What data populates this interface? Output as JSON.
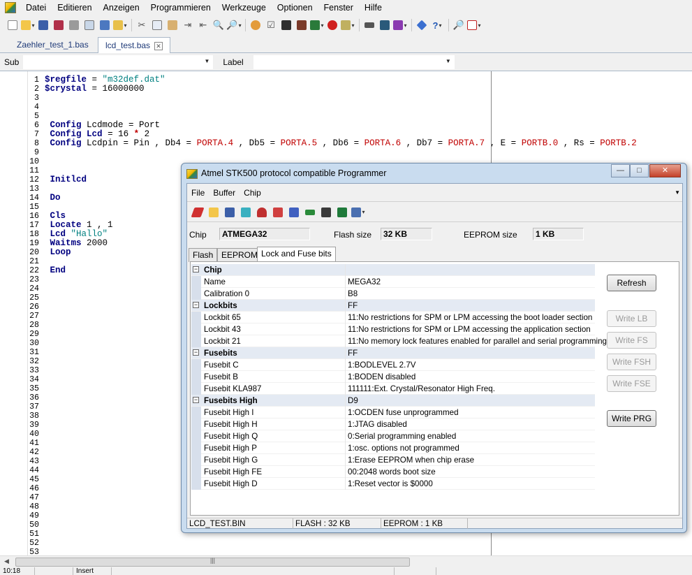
{
  "menu": [
    "Datei",
    "Editieren",
    "Anzeigen",
    "Programmieren",
    "Werkzeuge",
    "Optionen",
    "Fenster",
    "Hilfe"
  ],
  "doc_tabs": [
    {
      "label": "Zaehler_test_1.bas",
      "active": false
    },
    {
      "label": "lcd_test.bas",
      "active": true
    }
  ],
  "sub_label_bar": {
    "sub": "Sub",
    "label": "Label"
  },
  "editor": {
    "lines": [
      {
        "n": "1",
        "html": "<span class=\"kw\">$regfile</span> = <span class=\"str\">\"m32def.dat\"</span>"
      },
      {
        "n": "2",
        "html": "<span class=\"kw\">$crystal</span> = 16000000"
      },
      {
        "n": "3",
        "html": ""
      },
      {
        "n": "4",
        "html": ""
      },
      {
        "n": "5",
        "html": ""
      },
      {
        "n": "6",
        "html": " <span class=\"kw\">Config</span> Lcdmode = Port"
      },
      {
        "n": "7",
        "html": " <span class=\"kw\">Config</span> <span class=\"kw\">Lcd</span> = 16 <span class=\"op\">*</span> 2"
      },
      {
        "n": "8",
        "html": " <span class=\"kw\">Config</span> Lcdpin = Pin , Db4 = <span class=\"op\" style=\"font-weight:normal\">PORTA.4</span> , Db5 = <span class=\"op\" style=\"font-weight:normal\">PORTA.5</span> , Db6 = <span class=\"op\" style=\"font-weight:normal\">PORTA.6</span> , Db7 = <span class=\"op\" style=\"font-weight:normal\">PORTA.7</span> , E = <span class=\"op\" style=\"font-weight:normal\">PORTB.0</span> , Rs = <span class=\"op\" style=\"font-weight:normal\">PORTB.2</span>"
      },
      {
        "n": "9",
        "html": ""
      },
      {
        "n": "10",
        "html": ""
      },
      {
        "n": "11",
        "html": ""
      },
      {
        "n": "12",
        "html": " <span class=\"kw\">Initlcd</span>"
      },
      {
        "n": "13",
        "html": ""
      },
      {
        "n": "14",
        "html": " <span class=\"kw\">Do</span>"
      },
      {
        "n": "15",
        "html": ""
      },
      {
        "n": "16",
        "html": " <span class=\"kw\">Cls</span>"
      },
      {
        "n": "17",
        "html": " <span class=\"kw\">Locate</span> 1 , 1"
      },
      {
        "n": "18",
        "html": " <span class=\"kw\">Lcd</span> <span class=\"str\">\"Hallo\"</span>"
      },
      {
        "n": "19",
        "html": " <span class=\"kw\">Waitms</span> 2000"
      },
      {
        "n": "20",
        "html": " <span class=\"kw\">Loop</span>"
      },
      {
        "n": "21",
        "html": ""
      },
      {
        "n": "22",
        "html": " <span class=\"kw\">End</span>"
      }
    ],
    "extra_line_numbers": [
      "23",
      "24",
      "25",
      "26",
      "27",
      "28",
      "29",
      "30",
      "31",
      "32",
      "33",
      "34",
      "35",
      "36",
      "37",
      "38",
      "39",
      "40",
      "41",
      "42",
      "43",
      "44",
      "45",
      "46",
      "47",
      "48",
      "49",
      "50",
      "51",
      "52",
      "53"
    ]
  },
  "statusbar": [
    "10:18",
    "",
    "Insert",
    "",
    ""
  ],
  "dialog": {
    "title": "Atmel STK500 protocol compatible Programmer",
    "menu": [
      "File",
      "Buffer",
      "Chip"
    ],
    "chip_label": "Chip",
    "chip_value": "ATMEGA32",
    "flash_label": "Flash size",
    "flash_value": "32 KB",
    "eeprom_label": "EEPROM size",
    "eeprom_value": "1 KB",
    "tabs": [
      {
        "label": "Flash",
        "active": false
      },
      {
        "label": "EEPROM",
        "active": false
      },
      {
        "label": "Lock and Fuse bits",
        "active": true
      }
    ],
    "rows": [
      {
        "type": "cat",
        "k": "Chip",
        "v": ""
      },
      {
        "type": "item",
        "k": "Name",
        "v": "MEGA32"
      },
      {
        "type": "item",
        "k": "Calibration 0",
        "v": "B8"
      },
      {
        "type": "cat",
        "k": "Lockbits",
        "v": "FF"
      },
      {
        "type": "item",
        "k": "Lockbit 65",
        "v": "11:No restrictions for SPM or LPM accessing the boot loader section"
      },
      {
        "type": "item",
        "k": "Lockbit 43",
        "v": "11:No restrictions for SPM or LPM accessing the application section"
      },
      {
        "type": "item",
        "k": "Lockbit 21",
        "v": "11:No memory lock features enabled for parallel and serial programming"
      },
      {
        "type": "cat",
        "k": "Fusebits",
        "v": "FF"
      },
      {
        "type": "item",
        "k": "Fusebit C",
        "v": "1:BODLEVEL 2.7V"
      },
      {
        "type": "item",
        "k": "Fusebit B",
        "v": "1:BODEN disabled"
      },
      {
        "type": "item",
        "k": "Fusebit KLA987",
        "v": "111111:Ext. Crystal/Resonator High Freq."
      },
      {
        "type": "cat",
        "k": "Fusebits High",
        "v": "D9"
      },
      {
        "type": "item",
        "k": "Fusebit High I",
        "v": "1:OCDEN fuse unprogrammed"
      },
      {
        "type": "item",
        "k": "Fusebit High H",
        "v": "1:JTAG disabled"
      },
      {
        "type": "item",
        "k": "Fusebit High Q",
        "v": "0:Serial programming enabled"
      },
      {
        "type": "item",
        "k": "Fusebit High P",
        "v": "1:osc. options not programmed"
      },
      {
        "type": "item",
        "k": "Fusebit High G",
        "v": "1:Erase EEPROM when chip erase"
      },
      {
        "type": "item",
        "k": "Fusebit High FE",
        "v": "00:2048 words boot size"
      },
      {
        "type": "item",
        "k": "Fusebit High D",
        "v": "1:Reset vector is $0000"
      }
    ],
    "buttons": [
      {
        "label": "Refresh",
        "enabled": true
      },
      {
        "label": "Write LB",
        "enabled": false
      },
      {
        "label": "Write FS",
        "enabled": false
      },
      {
        "label": "Write FSH",
        "enabled": false
      },
      {
        "label": "Write FSE",
        "enabled": false
      },
      {
        "label": "Write PRG",
        "enabled": true
      }
    ],
    "status": [
      "LCD_TEST.BIN",
      "FLASH : 32 KB",
      "EEPROM : 1 KB",
      ""
    ]
  }
}
